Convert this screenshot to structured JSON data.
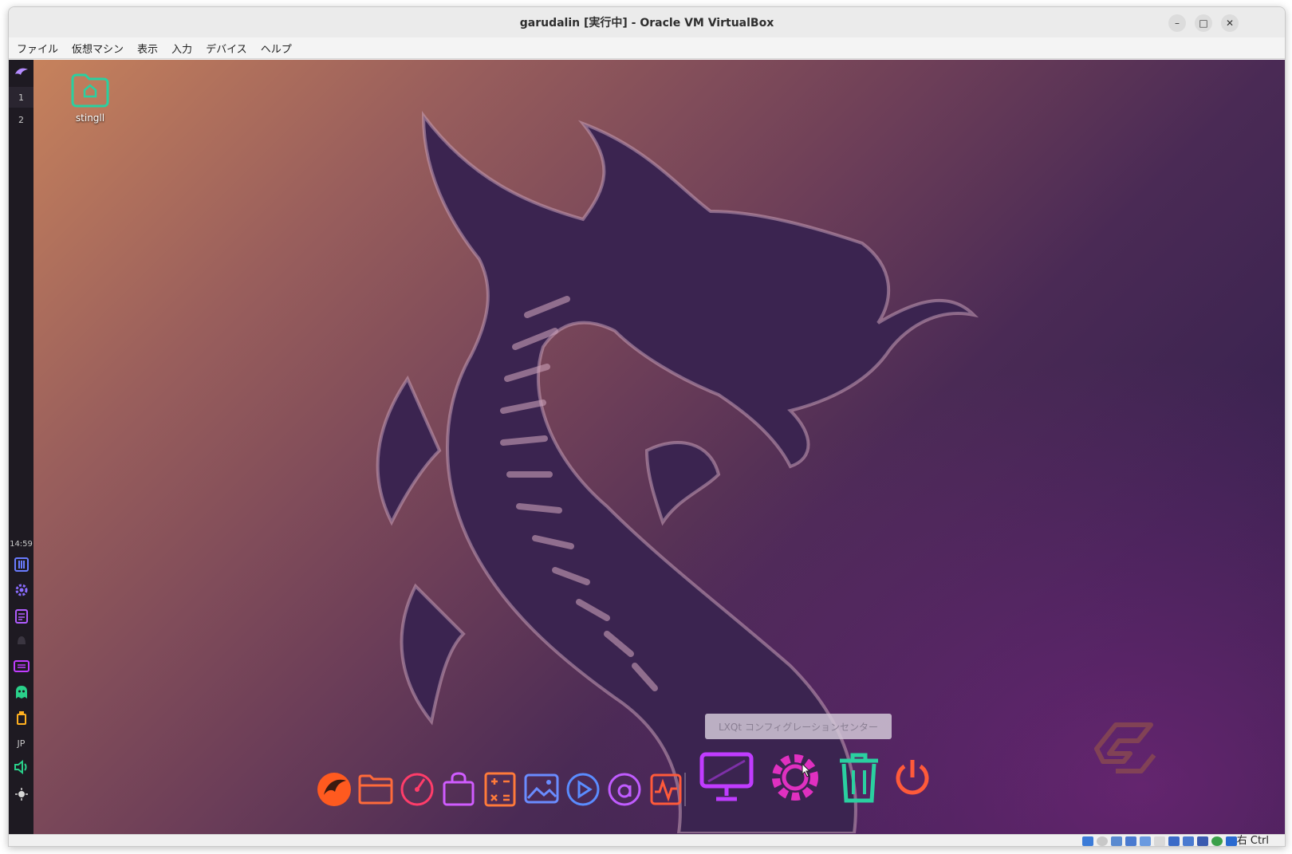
{
  "window": {
    "title": "garudalin [実行中] - Oracle VM VirtualBox",
    "minimize_glyph": "–",
    "maximize_glyph": "□",
    "close_glyph": "✕"
  },
  "menubar": {
    "items": [
      {
        "label": "ファイル"
      },
      {
        "label": "仮想マシン"
      },
      {
        "label": "表示"
      },
      {
        "label": "入力"
      },
      {
        "label": "デバイス"
      },
      {
        "label": "ヘルプ"
      }
    ]
  },
  "guest": {
    "left_panel": {
      "workspaces": [
        "1",
        "2"
      ],
      "clock": "14:59",
      "keyboard_layout": "JP"
    },
    "desktop_icon": {
      "label": "stingll"
    },
    "dock": {
      "apps": [
        {
          "icon": "garuda-dragon-icon",
          "color": "#ff5a1f"
        },
        {
          "icon": "folder-icon",
          "color": "#ff6a3a"
        },
        {
          "icon": "gauge-icon",
          "color": "#ff3d6a"
        },
        {
          "icon": "shopping-bag-icon",
          "color": "#d05cff"
        },
        {
          "icon": "calculator-icon",
          "color": "#ff7a3a"
        },
        {
          "icon": "image-viewer-icon",
          "color": "#6a8cff"
        },
        {
          "icon": "media-player-icon",
          "color": "#5a8cff"
        },
        {
          "icon": "at-sign-icon",
          "color": "#c05cff"
        },
        {
          "icon": "system-monitor-icon",
          "color": "#ff5a3a"
        }
      ],
      "system": [
        {
          "icon": "display-settings-icon",
          "color": "#c03cff"
        },
        {
          "icon": "gear-icon",
          "color": "#e030c0"
        },
        {
          "icon": "trash-icon",
          "color": "#2ad0a0"
        },
        {
          "icon": "power-icon",
          "color": "#ff5a3a"
        }
      ]
    },
    "tooltip": "LXQt コンフィグレーションセンター"
  },
  "statusbar": {
    "host_key": "右 Ctrl"
  }
}
